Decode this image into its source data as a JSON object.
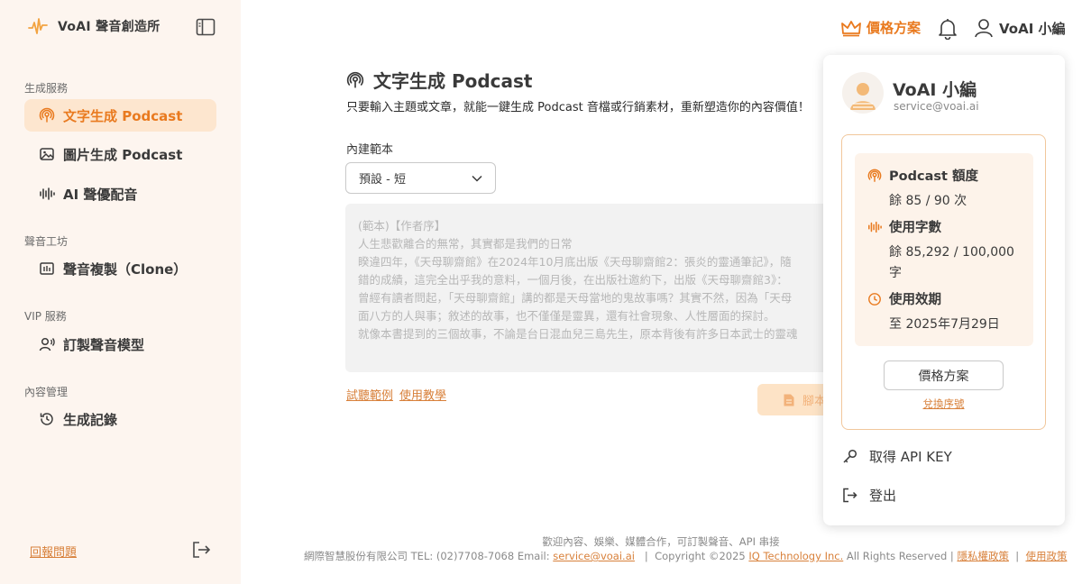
{
  "app": {
    "name": "VoAI 聲音創造所"
  },
  "sidebar": {
    "sections": [
      {
        "label": "生成服務"
      },
      {
        "label": "聲音工坊"
      },
      {
        "label": "VIP 服務"
      },
      {
        "label": "內容管理"
      }
    ],
    "items": [
      {
        "label": "文字生成 Podcast",
        "icon": "podcast-icon",
        "active": true
      },
      {
        "label": "圖片生成 Podcast",
        "icon": "image-icon",
        "active": false
      },
      {
        "label": "AI 聲優配音",
        "icon": "soundwave-icon",
        "active": false
      },
      {
        "label": "聲音複製（Clone）",
        "icon": "voice-clone-icon",
        "active": false
      },
      {
        "label": "訂製聲音模型",
        "icon": "user-voice-icon",
        "active": false
      },
      {
        "label": "生成記錄",
        "icon": "history-icon",
        "active": false
      }
    ],
    "report_label": "回報問題"
  },
  "header": {
    "pricing_label": "價格方案",
    "user_label": "VoAI 小編"
  },
  "main": {
    "title": "文字生成 Podcast",
    "subtitle": "只要輸入主題或文章，就能一鍵生成 Podcast 音檔或行銷素材，重新塑造你的內容價值！",
    "template_label": "內建範本",
    "template_value": "預設 - 短",
    "textarea_lines": [
      "(範本)【作者序】",
      "人生悲歡離合的無常，其實都是我們的日常",
      "睽違四年，《天母聊齋館》在2024年10月底出版《天母聊齋館2：張炎的靈通筆記》，隨",
      "錯的成績，這完全出乎我的意料，一個月後，在出版社邀約下，出版《天母聊齋館3》：",
      "曾經有讀者問起，「天母聊齋館」講的都是天母當地的鬼故事嗎？其實不然，因為「天母",
      "面八方的人與事；敘述的故事，也不僅僅是靈異，還有社會現象、人性層面的探討。",
      "就像本書提到的三個故事，不論是台日混血兒三島先生，原本背後有許多日本武士的靈魂"
    ],
    "sample_link": "試聽範例",
    "tutorial_link": "使用教學",
    "script_button": "腳本"
  },
  "footer": {
    "line1": "歡迎內容、娛樂、媒體合作，可訂製聲音、API 串接",
    "company": "網際智慧股份有限公司 TEL: (02)7708-7068 Email:",
    "email": "service@voai.ai",
    "sep1": "|",
    "copyright": "Copyright ©2025",
    "company_link": "IQ Technology Inc.",
    "rights": "All Rights Reserved |",
    "privacy": "隱私權政策",
    "sep2": "|",
    "terms": "使用政策"
  },
  "dropdown": {
    "name": "VoAI 小編",
    "email": "service@voai.ai",
    "quota": [
      {
        "title": "Podcast 額度",
        "value": "餘 85 / 90 次",
        "icon": "podcast-icon"
      },
      {
        "title": "使用字數",
        "value": "餘 85,292 / 100,000 字",
        "icon": "soundwave-icon"
      },
      {
        "title": "使用效期",
        "value": "至 2025年7月29日",
        "icon": "clock-icon"
      }
    ],
    "pricing_button": "價格方案",
    "redeem_link": "兌換序號",
    "api_key": "取得 API KEY",
    "logout": "登出"
  },
  "colors": {
    "accent": "#e97a1f",
    "sidebar_bg": "#fdf5ef",
    "active_bg": "#fde6cf"
  }
}
